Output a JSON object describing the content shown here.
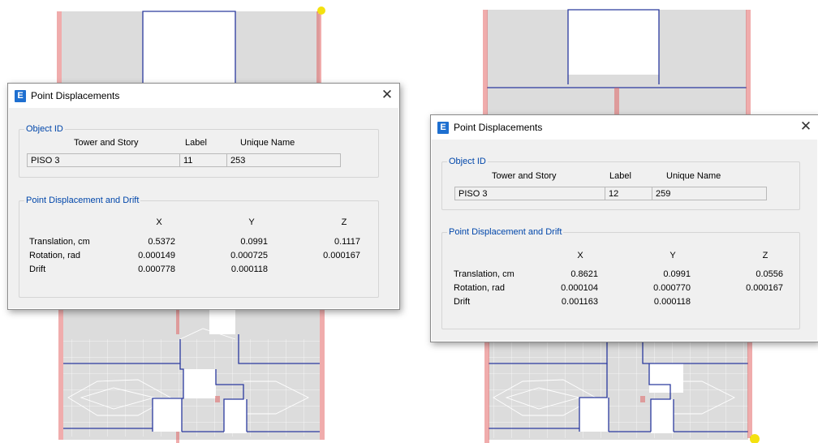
{
  "dialogs": [
    {
      "title": "Point Displacements",
      "object_id": {
        "legend": "Object ID",
        "headers": {
          "tower_story": "Tower and Story",
          "label": "Label",
          "unique_name": "Unique Name"
        },
        "tower_story": "PISO 3",
        "label": "11",
        "unique_name": "253"
      },
      "displacement": {
        "legend": "Point Displacement and Drift",
        "columns": [
          "X",
          "Y",
          "Z"
        ],
        "rows": [
          {
            "label": "Translation, cm",
            "values": [
              "0.5372",
              "0.0991",
              "0.1117"
            ]
          },
          {
            "label": "Rotation, rad",
            "values": [
              "0.000149",
              "0.000725",
              "0.000167"
            ]
          },
          {
            "label": "Drift",
            "values": [
              "0.000778",
              "0.000118",
              ""
            ]
          }
        ]
      }
    },
    {
      "title": "Point Displacements",
      "object_id": {
        "legend": "Object ID",
        "headers": {
          "tower_story": "Tower and Story",
          "label": "Label",
          "unique_name": "Unique Name"
        },
        "tower_story": "PISO 3",
        "label": "12",
        "unique_name": "259"
      },
      "displacement": {
        "legend": "Point Displacement and Drift",
        "columns": [
          "X",
          "Y",
          "Z"
        ],
        "rows": [
          {
            "label": "Translation, cm",
            "values": [
              "0.8621",
              "0.0991",
              "0.0556"
            ]
          },
          {
            "label": "Rotation, rad",
            "values": [
              "0.000104",
              "0.000770",
              "0.000167"
            ]
          },
          {
            "label": "Drift",
            "values": [
              "0.001163",
              "0.000118",
              ""
            ]
          }
        ]
      }
    }
  ],
  "icons": {
    "app": "etabs-app-icon",
    "close": "close-icon"
  },
  "colors": {
    "slab": "#dcdcdc",
    "beam": "#2b3a9e",
    "column": "#e05a5a",
    "mesh": "#ffffff",
    "selected_point": "#f4e10f",
    "legend_text": "#0046aa"
  }
}
